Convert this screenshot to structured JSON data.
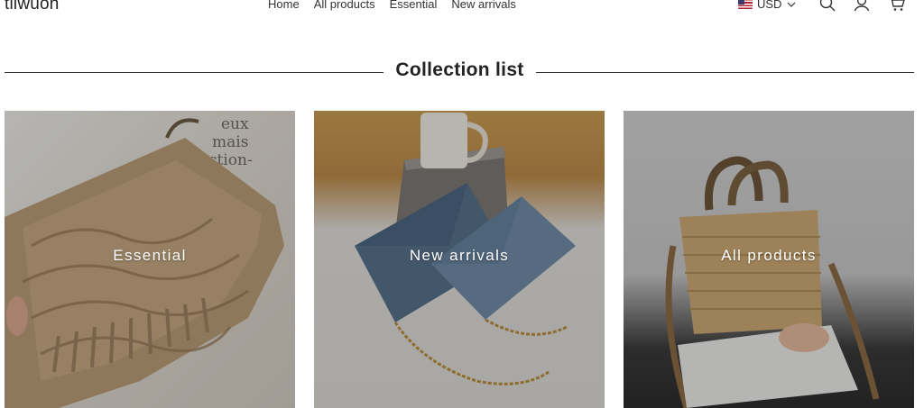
{
  "header": {
    "logo": "tliwuon",
    "nav": [
      {
        "label": "Home"
      },
      {
        "label": "All products"
      },
      {
        "label": "Essential"
      },
      {
        "label": "New arrivals"
      }
    ],
    "currency": {
      "code": "USD",
      "flag_icon": "us-flag-icon"
    },
    "icons": [
      "search-icon",
      "account-icon",
      "cart-icon"
    ]
  },
  "section": {
    "title": "Collection list"
  },
  "collections": [
    {
      "label": "Essential"
    },
    {
      "label": "New arrivals"
    },
    {
      "label": "All products"
    }
  ]
}
